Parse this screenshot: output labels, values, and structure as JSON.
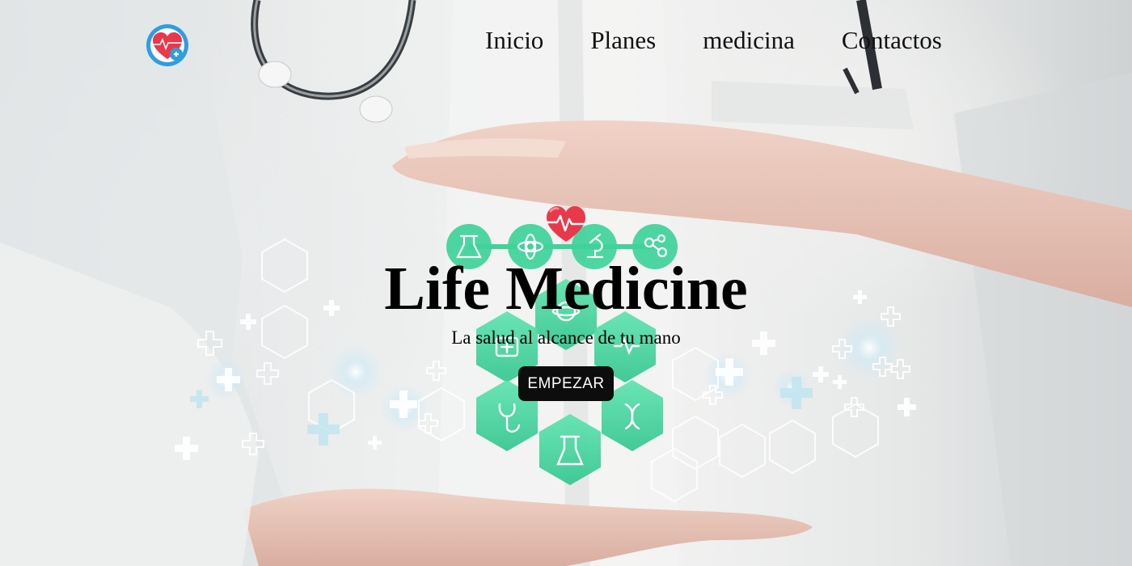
{
  "page": {
    "brand_logo": "heart-medical-logo"
  },
  "nav": {
    "items": [
      {
        "label": "Inicio"
      },
      {
        "label": "Planes"
      },
      {
        "label": "medicina"
      },
      {
        "label": "Contactos"
      }
    ]
  },
  "hero": {
    "title": "Life Medicine",
    "subtitle": "La salud al alcance de tu mano",
    "cta_label": "EMPEZAR"
  },
  "colors": {
    "accent_green": "#3fd39a",
    "heart_red": "#e8394a",
    "logo_blue": "#2f9de0",
    "cta_bg": "#0d0d0d"
  }
}
